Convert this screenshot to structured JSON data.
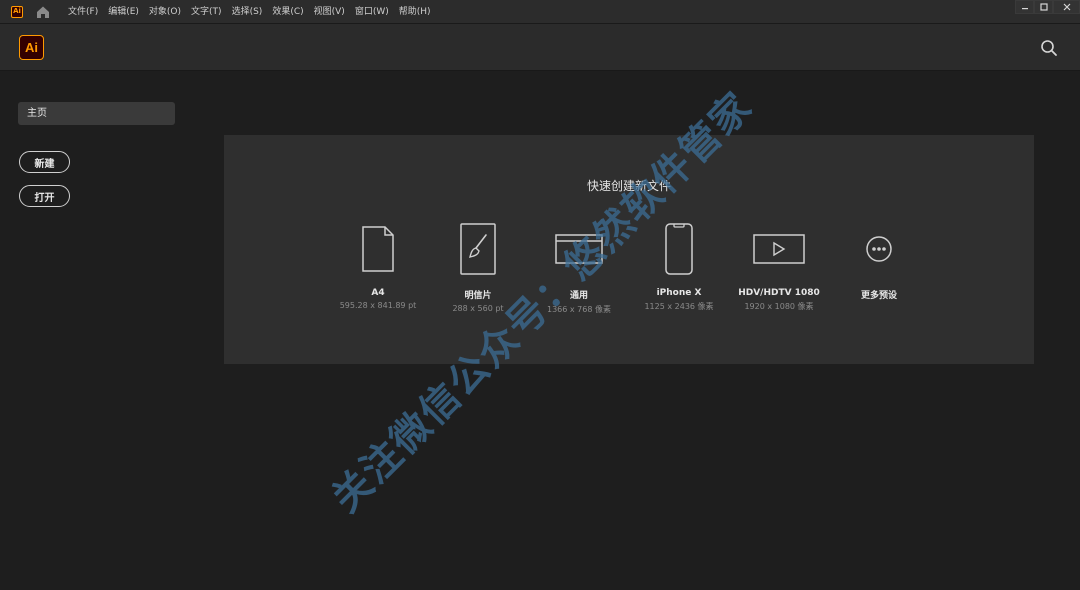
{
  "titlebar": {
    "logo_text": "Ai",
    "menu": [
      "文件(F)",
      "编辑(E)",
      "对象(O)",
      "文字(T)",
      "选择(S)",
      "效果(C)",
      "视图(V)",
      "窗口(W)",
      "帮助(H)"
    ],
    "window_controls": {
      "minimize": "▬",
      "maximize": "▢",
      "close": "✕"
    }
  },
  "header": {
    "logo_text": "Ai",
    "search_icon": "search-icon"
  },
  "sidebar": {
    "home_label": "主页",
    "new_label": "新建",
    "open_label": "打开"
  },
  "quick_create": {
    "title": "快速创建新文件",
    "presets": [
      {
        "name": "A4",
        "size": "595.28 x 841.89 pt",
        "icon": "document-icon"
      },
      {
        "name": "明信片",
        "size": "288 x 560 pt",
        "icon": "postcard-brush-icon"
      },
      {
        "name": "通用",
        "size": "1366 x 768 像素",
        "icon": "browser-window-icon"
      },
      {
        "name": "iPhone X",
        "size": "1125 x 2436 像素",
        "icon": "phone-icon"
      },
      {
        "name": "HDV/HDTV 1080",
        "size": "1920 x 1080 像素",
        "icon": "video-play-icon"
      },
      {
        "name": "更多预设",
        "size": "",
        "icon": "more-options-icon"
      }
    ]
  },
  "watermark": "关注微信公众号：悠然软件管家",
  "colors": {
    "accent": "#ff9a00",
    "logo_bg": "#330000",
    "background": "#1e1e1e",
    "panel": "#2f2f2f"
  }
}
